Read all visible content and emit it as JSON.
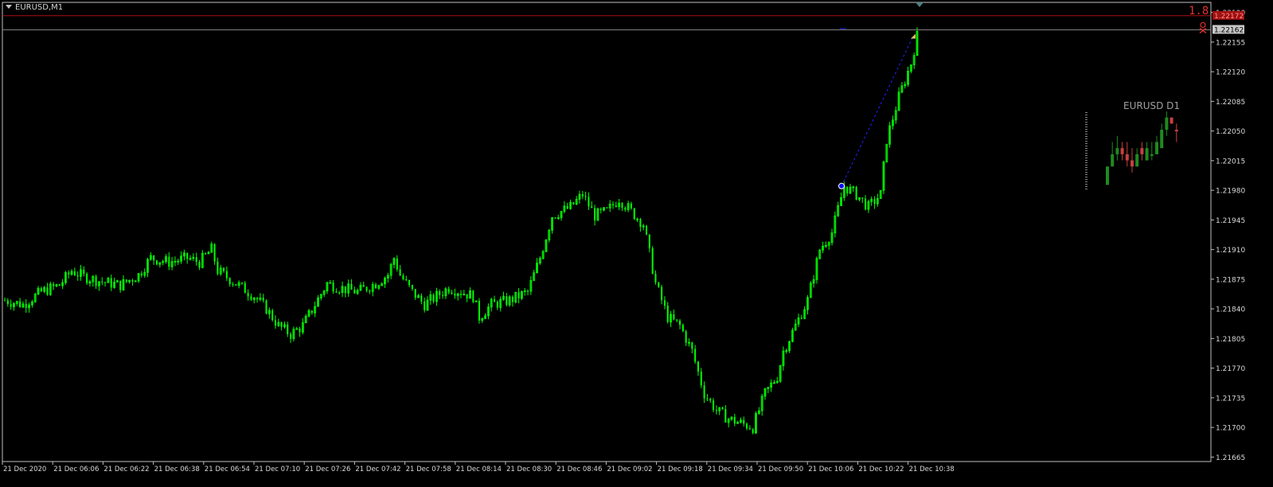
{
  "window": {
    "symbol_title": "EURUSD,M1"
  },
  "colors": {
    "background": "#000000",
    "grid_frame": "#c0c0c0",
    "bull_candle": "#00ff00",
    "bear_candle": "#00ff00",
    "bid_line": "#808080",
    "stop_line": "#b01010",
    "trade_line": "#2020ff",
    "mini_bull": "#1f8a1f",
    "mini_bear": "#c84040"
  },
  "overlay": {
    "stop_label": "1.8",
    "stop_price_tag": "1.22172",
    "bid_price_tag": "1.22162",
    "trade_entry_price": 1.21985,
    "trade_exit_price": 1.22162,
    "stop_price": 1.22172,
    "bid_price": 1.22162,
    "top_marker_price": 1.22185
  },
  "mini_chart": {
    "title": "EURUSD D1",
    "candles": [
      {
        "o": 1.2198,
        "h": 1.2201,
        "l": 1.2198,
        "c": 1.2201,
        "bull": true
      },
      {
        "o": 1.2201,
        "h": 1.2205,
        "l": 1.2201,
        "c": 1.2203,
        "bull": true
      },
      {
        "o": 1.2203,
        "h": 1.2206,
        "l": 1.2202,
        "c": 1.2204,
        "bull": true
      },
      {
        "o": 1.2204,
        "h": 1.2205,
        "l": 1.2202,
        "c": 1.2203,
        "bull": false
      },
      {
        "o": 1.2203,
        "h": 1.2205,
        "l": 1.2201,
        "c": 1.2202,
        "bull": false
      },
      {
        "o": 1.2202,
        "h": 1.2204,
        "l": 1.22,
        "c": 1.2201,
        "bull": false
      },
      {
        "o": 1.2201,
        "h": 1.2204,
        "l": 1.2201,
        "c": 1.2203,
        "bull": true
      },
      {
        "o": 1.2203,
        "h": 1.2205,
        "l": 1.2202,
        "c": 1.2204,
        "bull": false
      },
      {
        "o": 1.2202,
        "h": 1.2205,
        "l": 1.2202,
        "c": 1.2204,
        "bull": true
      },
      {
        "o": 1.2203,
        "h": 1.2205,
        "l": 1.2202,
        "c": 1.2203,
        "bull": true
      },
      {
        "o": 1.2203,
        "h": 1.2206,
        "l": 1.2203,
        "c": 1.2205,
        "bull": true
      },
      {
        "o": 1.2204,
        "h": 1.2208,
        "l": 1.2204,
        "c": 1.2207,
        "bull": true
      },
      {
        "o": 1.2207,
        "h": 1.221,
        "l": 1.2206,
        "c": 1.2209,
        "bull": true
      },
      {
        "o": 1.2209,
        "h": 1.2209,
        "l": 1.2208,
        "c": 1.2208,
        "bull": false
      },
      {
        "o": 1.2207,
        "h": 1.2208,
        "l": 1.2205,
        "c": 1.2207,
        "bull": false
      }
    ]
  },
  "chart_data": {
    "type": "candlestick",
    "title": "EURUSD,M1",
    "xlabel": "",
    "ylabel": "",
    "ylim": [
      1.21655,
      1.222
    ],
    "y_ticks": [
      "1.22190",
      "1.22155",
      "1.22120",
      "1.22085",
      "1.22050",
      "1.22015",
      "1.21980",
      "1.21945",
      "1.21910",
      "1.21875",
      "1.21840",
      "1.21805",
      "1.21770",
      "1.21735",
      "1.21700",
      "1.21665"
    ],
    "x_ticks": [
      "21 Dec 2020",
      "21 Dec 06:06",
      "21 Dec 06:22",
      "21 Dec 06:38",
      "21 Dec 06:54",
      "21 Dec 07:10",
      "21 Dec 07:26",
      "21 Dec 07:42",
      "21 Dec 07:58",
      "21 Dec 08:14",
      "21 Dec 08:30",
      "21 Dec 08:46",
      "21 Dec 09:02",
      "21 Dec 09:18",
      "21 Dec 09:34",
      "21 Dec 09:50",
      "21 Dec 10:06",
      "21 Dec 10:22",
      "21 Dec 10:38"
    ],
    "close_path": [
      [
        0,
        1.2185
      ],
      [
        6,
        1.21845
      ],
      [
        12,
        1.2186
      ],
      [
        18,
        1.21868
      ],
      [
        22,
        1.21885
      ],
      [
        26,
        1.21878
      ],
      [
        32,
        1.21872
      ],
      [
        38,
        1.21868
      ],
      [
        44,
        1.2188
      ],
      [
        48,
        1.219
      ],
      [
        54,
        1.21895
      ],
      [
        60,
        1.219
      ],
      [
        64,
        1.21895
      ],
      [
        68,
        1.2191
      ],
      [
        70,
        1.21885
      ],
      [
        76,
        1.2187
      ],
      [
        82,
        1.21855
      ],
      [
        86,
        1.2184
      ],
      [
        90,
        1.2182
      ],
      [
        94,
        1.2181
      ],
      [
        98,
        1.2182
      ],
      [
        102,
        1.21845
      ],
      [
        106,
        1.2187
      ],
      [
        110,
        1.21865
      ],
      [
        116,
        1.2186
      ],
      [
        122,
        1.2187
      ],
      [
        126,
        1.2188
      ],
      [
        128,
        1.219
      ],
      [
        130,
        1.2188
      ],
      [
        134,
        1.2186
      ],
      [
        138,
        1.21845
      ],
      [
        142,
        1.21855
      ],
      [
        146,
        1.21865
      ],
      [
        150,
        1.2186
      ],
      [
        154,
        1.21855
      ],
      [
        156,
        1.2183
      ],
      [
        160,
        1.21845
      ],
      [
        166,
        1.2185
      ],
      [
        172,
        1.2186
      ],
      [
        176,
        1.219
      ],
      [
        180,
        1.2195
      ],
      [
        186,
        1.2196
      ],
      [
        190,
        1.21975
      ],
      [
        194,
        1.2195
      ],
      [
        198,
        1.21955
      ],
      [
        202,
        1.2197
      ],
      [
        206,
        1.21955
      ],
      [
        210,
        1.2194
      ],
      [
        214,
        1.2187
      ],
      [
        218,
        1.2183
      ],
      [
        222,
        1.2182
      ],
      [
        226,
        1.2179
      ],
      [
        230,
        1.2174
      ],
      [
        234,
        1.2172
      ],
      [
        238,
        1.2171
      ],
      [
        242,
        1.21705
      ],
      [
        246,
        1.217
      ],
      [
        250,
        1.2174
      ],
      [
        254,
        1.2176
      ],
      [
        256,
        1.2179
      ],
      [
        260,
        1.2182
      ],
      [
        264,
        1.2185
      ],
      [
        266,
        1.2188
      ],
      [
        268,
        1.2191
      ],
      [
        272,
        1.2193
      ],
      [
        276,
        1.21985
      ],
      [
        280,
        1.21975
      ],
      [
        284,
        1.2196
      ],
      [
        288,
        1.21975
      ],
      [
        290,
        1.2204
      ],
      [
        294,
        1.2209
      ],
      [
        298,
        1.2213
      ],
      [
        300,
        1.22162
      ]
    ]
  }
}
